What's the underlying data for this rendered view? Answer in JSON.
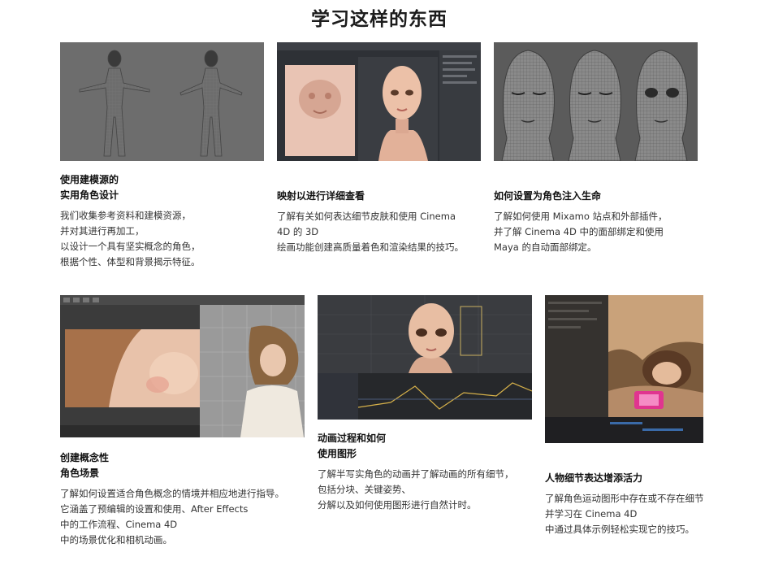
{
  "page": {
    "title": "学习这样的东西"
  },
  "cards": [
    {
      "title_lines": [
        "使用建模源的",
        "实用角色设计"
      ],
      "desc_lines": [
        "我们收集参考资料和建模资源，",
        "并对其进行再加工，",
        "以设计一个具有坚实概念的角色，",
        "根据个性、体型和背景揭示特征。"
      ]
    },
    {
      "title_lines": [
        "映射以进行详细查看"
      ],
      "desc_lines": [
        "了解有关如何表达细节皮肤和使用 Cinema",
        "4D 的 3D",
        "绘画功能创建高质量着色和渲染结果的技巧。"
      ]
    },
    {
      "title_lines": [
        "如何设置为角色注入生命"
      ],
      "desc_lines": [
        "了解如何使用 Mixamo 站点和外部插件，",
        "并了解 Cinema 4D 中的面部绑定和使用",
        "Maya 的自动面部绑定。"
      ]
    },
    {
      "title_lines": [
        "创建概念性",
        "角色场景"
      ],
      "desc_lines": [
        "了解如何设置适合角色概念的情境并相应地进行指导。",
        "它涵盖了预编辑的设置和使用、After Effects",
        "中的工作流程、Cinema 4D",
        "中的场景优化和相机动画。"
      ]
    },
    {
      "title_lines": [
        "动画过程和如何",
        "使用图形"
      ],
      "desc_lines": [
        "了解半写实角色的动画并了解动画的所有细节，",
        "包括分块、关键姿势、",
        "分解以及如何使用图形进行自然计时。"
      ]
    },
    {
      "title_lines": [
        "人物细节表达增添活力"
      ],
      "desc_lines": [
        "了解角色运动图形中存在或不存在细节的差异，",
        "并学习在 Cinema 4D",
        "中通过具体示例轻松实现它的技巧。"
      ]
    }
  ]
}
